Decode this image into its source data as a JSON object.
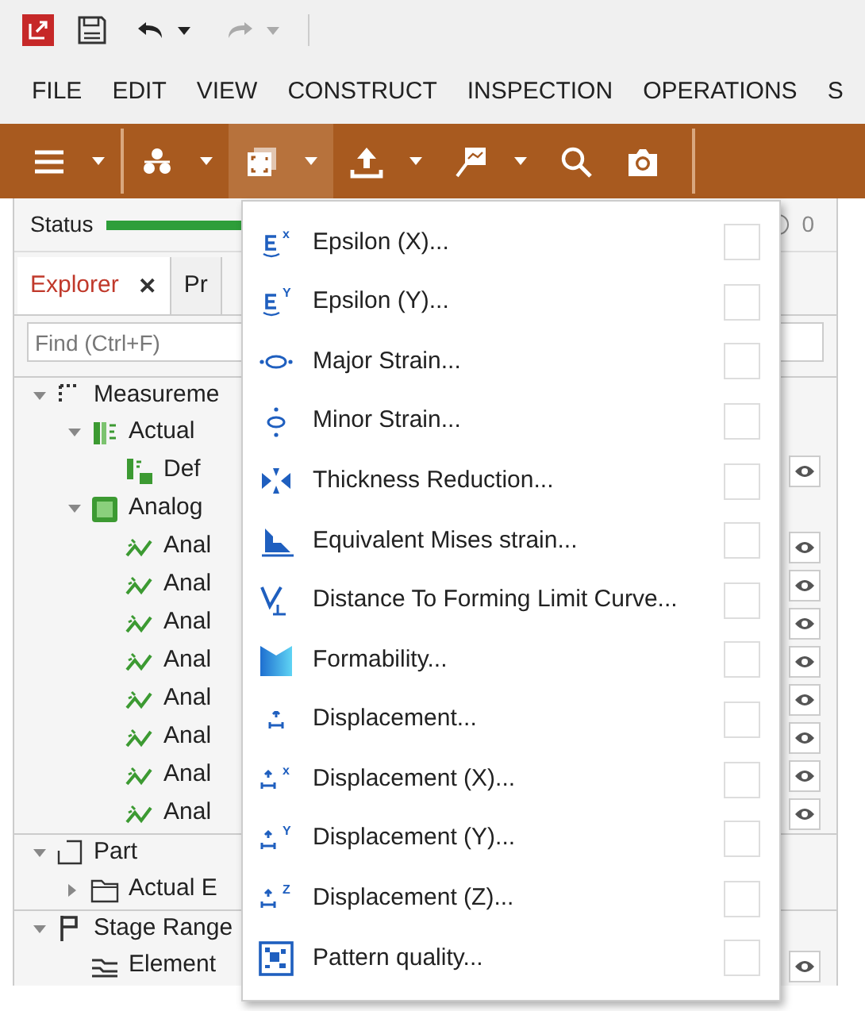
{
  "quick_access": [
    {
      "kind": "app"
    },
    {
      "kind": "save"
    },
    {
      "kind": "undo",
      "disabled": false
    },
    {
      "kind": "redo",
      "disabled": true
    }
  ],
  "menu_bar": [
    "FILE",
    "EDIT",
    "VIEW",
    "CONSTRUCT",
    "INSPECTION",
    "OPERATIONS",
    "S"
  ],
  "toolbar": [
    {
      "kind": "menu",
      "dropdown": true,
      "selected": false
    },
    {
      "kind": "points",
      "dropdown": true,
      "selected": false
    },
    {
      "kind": "frame",
      "dropdown": true,
      "selected": true
    },
    {
      "kind": "upload",
      "dropdown": true,
      "selected": false
    },
    {
      "kind": "flag",
      "dropdown": true,
      "selected": false
    },
    {
      "kind": "search",
      "dropdown": false,
      "selected": false
    },
    {
      "kind": "camera",
      "dropdown": false,
      "selected": false
    }
  ],
  "status": {
    "label": "Status",
    "count": "0"
  },
  "panel_tabs": [
    {
      "label": "Explorer",
      "selected": true,
      "close": "✕"
    },
    {
      "label": "Pr",
      "selected": false
    }
  ],
  "search": {
    "placeholder": "Find (Ctrl+F)"
  },
  "tree": [
    {
      "label": "Measureme",
      "kind": "measure",
      "expanded": true,
      "eye": false,
      "children": [
        {
          "label": "Actual",
          "kind": "actual",
          "expanded": true,
          "eye": false,
          "children": [
            {
              "label": "Def",
              "kind": "deform",
              "eye": true
            }
          ]
        },
        {
          "label": "Analog",
          "kind": "analog",
          "expanded": true,
          "eye": false,
          "children": [
            {
              "label": "Anal",
              "kind": "line",
              "eye": true
            },
            {
              "label": "Anal",
              "kind": "line",
              "eye": true
            },
            {
              "label": "Anal",
              "kind": "line",
              "eye": true
            },
            {
              "label": "Anal",
              "kind": "line",
              "eye": true
            },
            {
              "label": "Anal",
              "kind": "line",
              "eye": true
            },
            {
              "label": "Anal",
              "kind": "line",
              "eye": true
            },
            {
              "label": "Anal",
              "kind": "line",
              "eye": true
            },
            {
              "label": "Anal",
              "kind": "line",
              "eye": true
            }
          ]
        }
      ]
    },
    {
      "label": "Part",
      "kind": "part",
      "expanded": true,
      "eye": false,
      "children": [
        {
          "label": "Actual E",
          "kind": "folder",
          "expanded": false,
          "eye": false
        }
      ]
    },
    {
      "label": "Stage Range",
      "kind": "flag",
      "expanded": true,
      "eye": false,
      "children": [
        {
          "label": "Element",
          "kind": "element",
          "eye": true
        }
      ]
    }
  ],
  "dropdown_menu": [
    {
      "label": "Epsilon (X)...",
      "kind": "eps",
      "sup": "x",
      "checked": false
    },
    {
      "label": "Epsilon (Y)...",
      "kind": "eps",
      "sup": "Y",
      "checked": false
    },
    {
      "label": "Major Strain...",
      "kind": "major",
      "checked": false
    },
    {
      "label": "Minor Strain...",
      "kind": "minor",
      "checked": false
    },
    {
      "label": "Thickness Reduction...",
      "kind": "thick",
      "checked": false
    },
    {
      "label": "Equivalent Mises strain...",
      "kind": "mises",
      "checked": false
    },
    {
      "label": "Distance To Forming Limit Curve...",
      "kind": "flc",
      "checked": false
    },
    {
      "label": "Formability...",
      "kind": "form",
      "checked": false
    },
    {
      "label": "Displacement...",
      "kind": "disp",
      "checked": false
    },
    {
      "label": "Displacement (X)...",
      "kind": "disp",
      "sup": "x",
      "checked": false
    },
    {
      "label": "Displacement (Y)...",
      "kind": "disp",
      "sup": "Y",
      "checked": false
    },
    {
      "label": "Displacement (Z)...",
      "kind": "disp",
      "sup": "Z",
      "checked": false
    },
    {
      "label": "Pattern quality...",
      "kind": "pattern",
      "checked": false
    }
  ]
}
